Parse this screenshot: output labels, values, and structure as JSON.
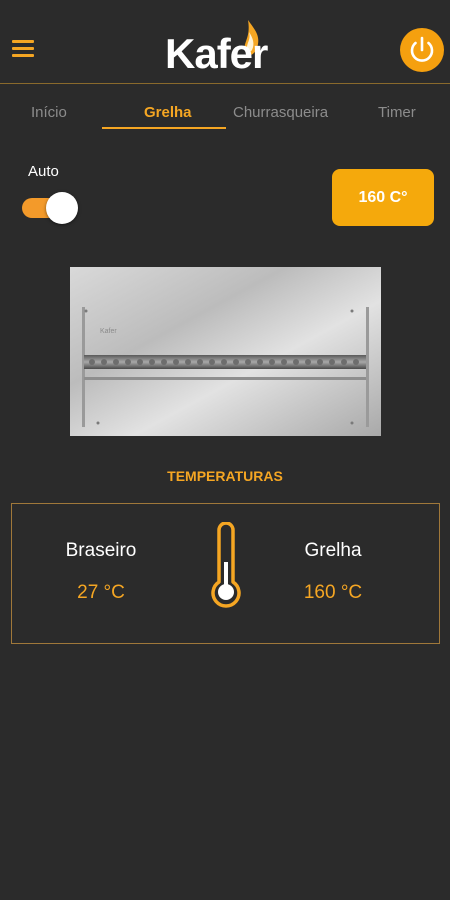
{
  "header": {
    "logo_text": "Kafer",
    "menu_icon": "hamburger-menu-icon",
    "power_icon": "power-icon"
  },
  "tabs": [
    {
      "label": "Início",
      "active": false
    },
    {
      "label": "Grelha",
      "active": true
    },
    {
      "label": "Churrasqueira",
      "active": false
    },
    {
      "label": "Timer",
      "active": false
    }
  ],
  "auto": {
    "label": "Auto",
    "enabled": true
  },
  "target_temp": {
    "label": "160 C°"
  },
  "grill_image_icon": "grill-photo",
  "temperatures": {
    "title": "TEMPERATURAS",
    "left": {
      "name": "Braseiro",
      "value": "27 °C"
    },
    "right": {
      "name": "Grelha",
      "value": "160 °C"
    },
    "thermometer_icon": "thermometer-icon"
  },
  "colors": {
    "background": "#2b2b2b",
    "accent": "#f5a623",
    "button": "#f5a90c"
  }
}
